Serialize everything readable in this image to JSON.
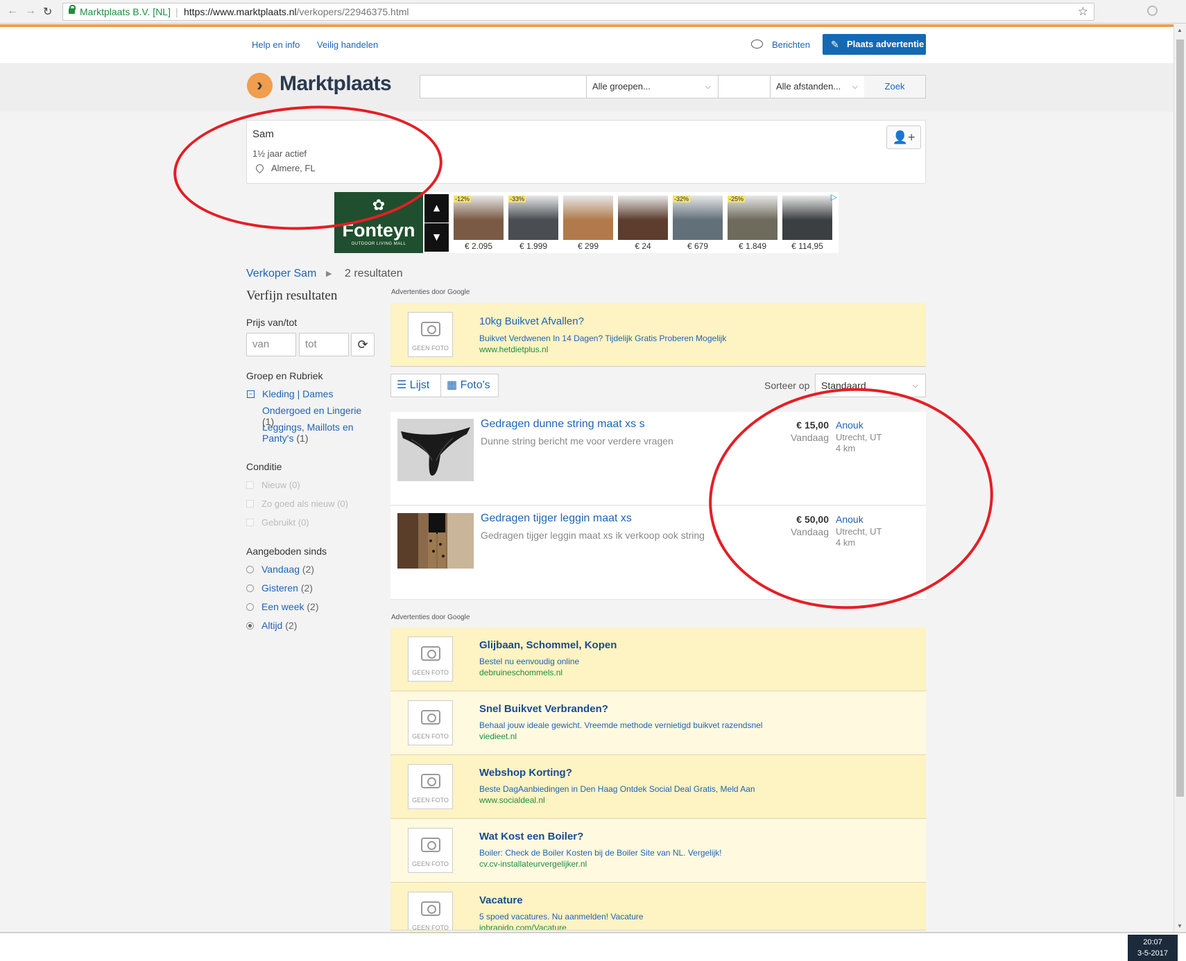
{
  "browser": {
    "site_identity": "Marktplaats B.V. [NL]",
    "url_separator": "|",
    "url_host": "https://www.marktplaats.nl",
    "url_path": "/verkopers/22946375.html",
    "back_icon": "←",
    "forward_icon": "→",
    "reload_icon": "↻",
    "star_icon": "☆"
  },
  "topnav": {
    "help": "Help en info",
    "safe": "Veilig handelen",
    "messages": "Berichten",
    "post_ad": "Plaats advertentie",
    "post_icon": "✎"
  },
  "header": {
    "logo_symbol": "›",
    "logo_text": "Marktplaats",
    "groups": "Alle groepen...",
    "distances": "Alle afstanden...",
    "search_button": "Zoek",
    "chevron": "⌵"
  },
  "seller": {
    "name": "Sam",
    "active": "1½ jaar actief",
    "location": "Almere, FL",
    "follow_icon": "👤+"
  },
  "banner": {
    "brand_symbol": "✿",
    "brand": "Fonteyn",
    "brand_sub": "OUTDOOR LIVING MALL",
    "up_icon": "▲",
    "down_icon": "▼",
    "adchoices_icon": "▷",
    "products": [
      {
        "discount": "-12%",
        "price": "€ 2.095",
        "color": "#7a5a44"
      },
      {
        "discount": "-33%",
        "price": "€ 1.999",
        "color": "#4a4e52"
      },
      {
        "discount": "",
        "price": "€ 299",
        "color": "#b07a4c"
      },
      {
        "discount": "",
        "price": "€ 24",
        "color": "#5c3d2e"
      },
      {
        "discount": "-32%",
        "price": "€ 679",
        "color": "#62707a"
      },
      {
        "discount": "-25%",
        "price": "€ 1.849",
        "color": "#6e6a5c"
      },
      {
        "discount": "",
        "price": "€ 114,95",
        "color": "#3c3f42"
      }
    ]
  },
  "breadcrumb": {
    "seller_link": "Verkoper Sam",
    "arrow": "▶",
    "count": "2 resultaten"
  },
  "sidebar": {
    "title": "Verfijn resultaten",
    "price_title": "Prijs van/tot",
    "price_from": "van",
    "price_to": "tot",
    "refresh_icon": "⟳",
    "group_title": "Groep en Rubriek",
    "collapse_icon": "−",
    "cat_main": "Kleding | Dames",
    "cat_sub1": "Ondergoed en Lingerie",
    "cat_sub1_count": "(1)",
    "cat_sub2": "Leggings, Maillots en Panty's",
    "cat_sub2_count": "(1)",
    "condition_title": "Conditie",
    "conditions": [
      "Nieuw (0)",
      "Zo goed als nieuw (0)",
      "Gebruikt (0)"
    ],
    "since_title": "Aangeboden sinds",
    "since": [
      {
        "label": "Vandaag",
        "count": "(2)"
      },
      {
        "label": "Gisteren",
        "count": "(2)"
      },
      {
        "label": "Een week",
        "count": "(2)"
      },
      {
        "label": "Altijd",
        "count": "(2)"
      }
    ]
  },
  "google_ads_label": "Advertenties door Google",
  "no_photo": "GEEN FOTO",
  "top_ad": {
    "title": "10kg Buikvet Afvallen?",
    "desc": "Buikvet Verdwenen In 14 Dagen? Tijdelijk Gratis Proberen Mogelijk",
    "url": "www.hetdietplus.nl"
  },
  "toolbar": {
    "list_icon": "☰",
    "list": "Lijst",
    "photos_icon": "▦",
    "photos": "Foto's",
    "sort_label": "Sorteer op",
    "sort_value": "Standaard"
  },
  "listings": [
    {
      "title": "Gedragen dunne string maat xs s",
      "desc": "Dunne string bericht me voor verdere vragen",
      "price": "€ 15,00",
      "date": "Vandaag",
      "seller": "Anouk",
      "city": "Utrecht, UT",
      "distance": "4 km"
    },
    {
      "title": "Gedragen tijger leggin maat xs",
      "desc": "Gedragen tijger leggin maat xs ik verkoop ook string",
      "price": "€ 50,00",
      "date": "Vandaag",
      "seller": "Anouk",
      "city": "Utrecht, UT",
      "distance": "4 km"
    }
  ],
  "bottom_ads": [
    {
      "title": "Glijbaan, Schommel, Kopen",
      "desc": "Bestel nu eenvoudig online",
      "url": "debruineschommels.nl"
    },
    {
      "title": "Snel Buikvet Verbranden?",
      "desc": "Behaal jouw ideale gewicht. Vreemde methode vernietigd buikvet razendsnel",
      "url": "viedieet.nl"
    },
    {
      "title": "Webshop Korting?",
      "desc": "Beste DagAanbiedingen in Den Haag Ontdek Social Deal Gratis, Meld Aan",
      "url": "www.socialdeal.nl"
    },
    {
      "title": "Wat Kost een Boiler?",
      "desc": "Boiler: Check de Boiler Kosten bij de Boiler Site van NL. Vergelijk!",
      "url": "cv.cv-installateurvergelijker.nl"
    },
    {
      "title": "Vacature",
      "desc": "5 spoed vacatures. Nu aanmelden! Vacature",
      "url": "jobrapido.com/Vacature"
    }
  ],
  "taskbar": {
    "time": "20:07",
    "date": "3-5-2017"
  }
}
